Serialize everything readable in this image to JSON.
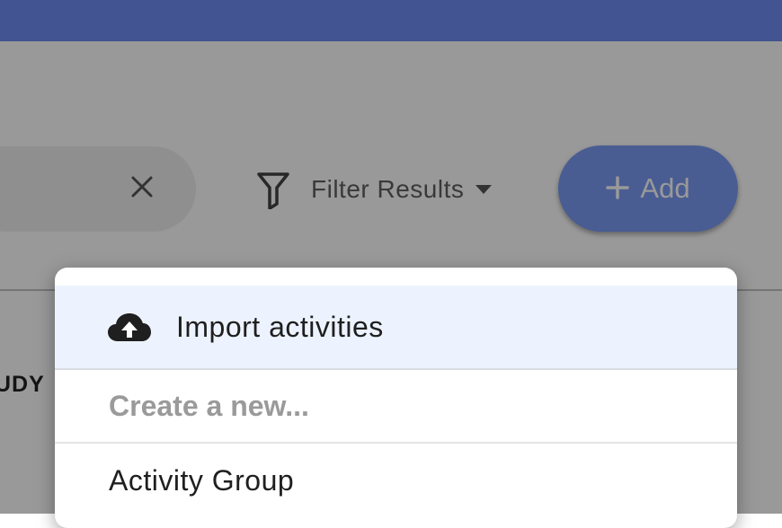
{
  "header": {
    "color": "#6f8cf2"
  },
  "toolbar": {
    "clear_icon": "close-icon",
    "filter_icon": "funnel-icon",
    "filter_label": "Filter Results",
    "add_label": "Add",
    "add_icon": "plus-icon",
    "accent": "#7b9cf5"
  },
  "table": {
    "partial_column_header": "UDY"
  },
  "add_menu": {
    "import_icon": "cloud-upload-icon",
    "import_label": "Import activities",
    "subheader": "Create a new...",
    "items": [
      {
        "label": "Activity Group"
      }
    ],
    "highlight": "#edf3fe"
  }
}
